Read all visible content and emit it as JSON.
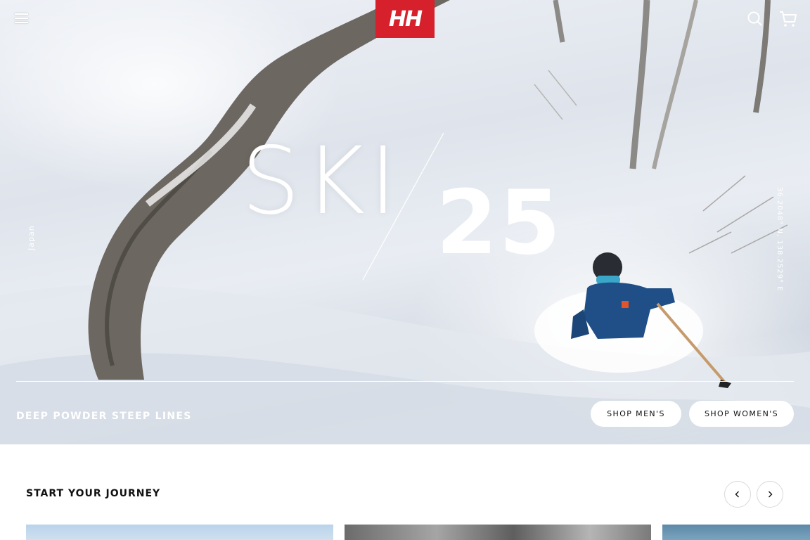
{
  "header": {
    "logo_text": "HH",
    "menu_icon": "hamburger-menu-icon",
    "search_icon": "search-icon",
    "cart_icon": "shopping-cart-icon",
    "brand_color": "#d6202c"
  },
  "hero": {
    "title_word": "SKI",
    "title_year": "25",
    "location": "Japan",
    "coordinates": "36.2048° N, 138.2529° E",
    "tagline": "DEEP POWDER STEEP LINES",
    "buttons": {
      "shop_men": "SHOP MEN'S",
      "shop_women": "SHOP WOMEN'S"
    }
  },
  "journey": {
    "title": "START YOUR JOURNEY",
    "prev_icon": "chevron-left-icon",
    "next_icon": "chevron-right-icon"
  }
}
